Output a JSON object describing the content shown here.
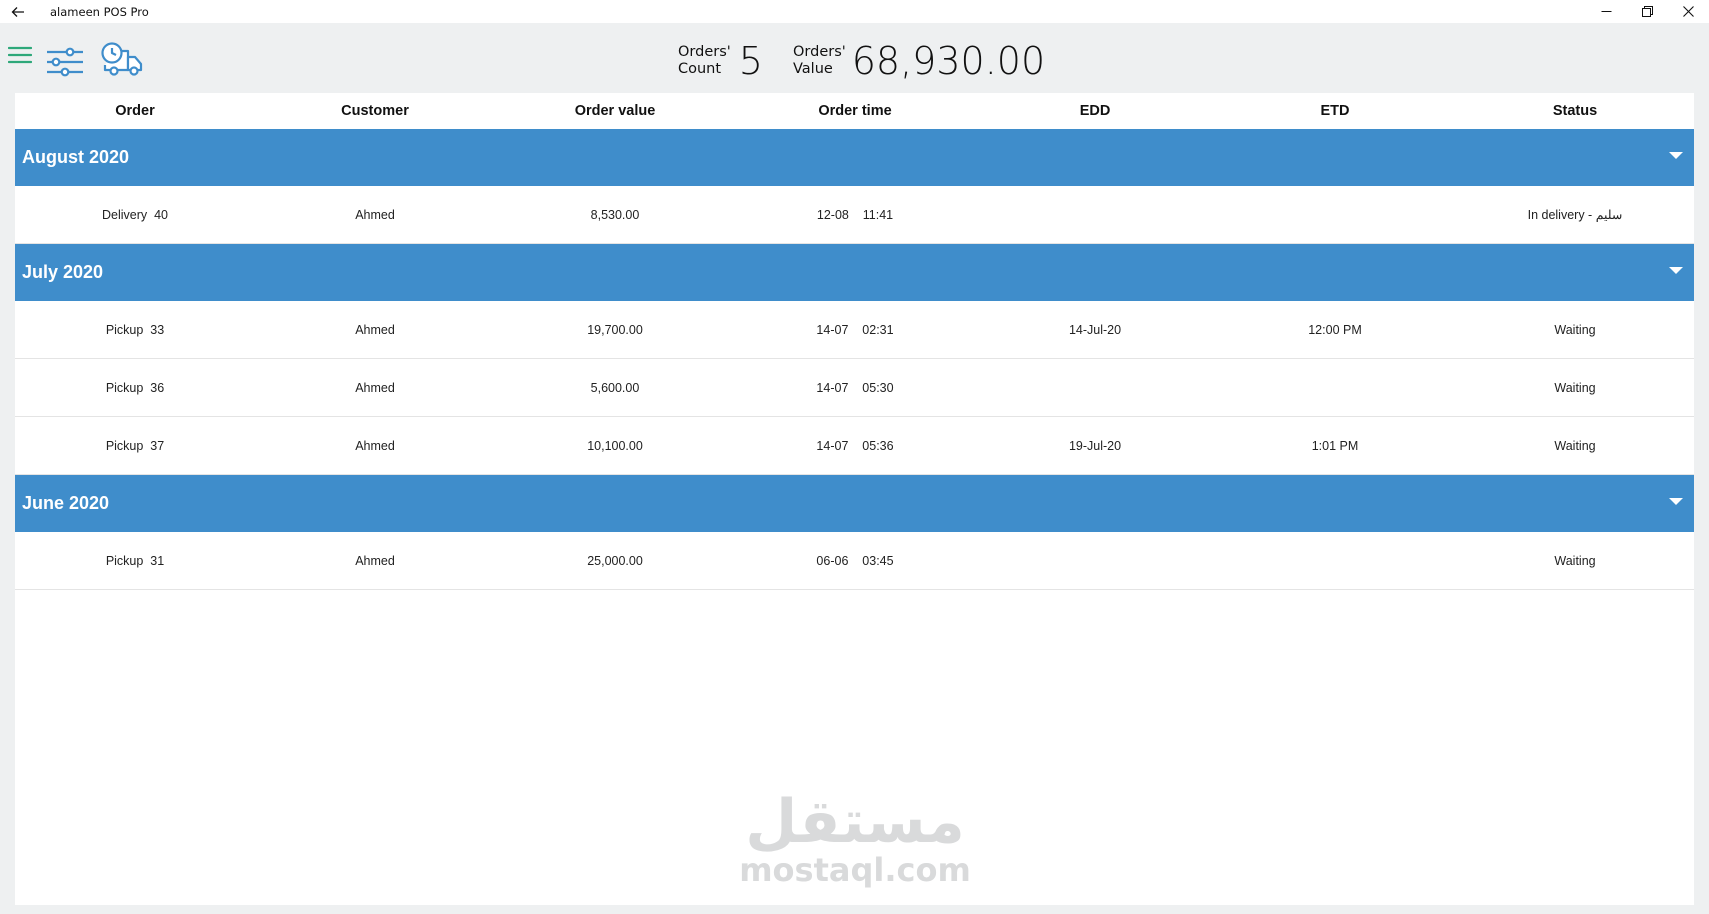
{
  "window": {
    "title": "alameen POS Pro",
    "controls": [
      "minimize-icon",
      "restore-icon",
      "close-icon"
    ]
  },
  "toolbar": {
    "icons": [
      "menu-icon",
      "filter-sliders-icon",
      "delivery-truck-clock-icon"
    ],
    "icon_color": "#3f8dcb",
    "menu_color": "#2ea87a"
  },
  "stats": {
    "count_label_1": "Orders'",
    "count_label_2": "Count",
    "count_value": "5",
    "value_label_1": "Orders'",
    "value_label_2": "Value",
    "value_value": "68,930.00"
  },
  "columns": [
    "Order",
    "Customer",
    "Order value",
    "Order time",
    "EDD",
    "ETD",
    "Status"
  ],
  "groups": [
    {
      "title": "August 2020",
      "rows": [
        {
          "order": "Delivery  40",
          "customer": "Ahmed",
          "value": "8,530.00",
          "time": "12-08    11:41",
          "edd": "",
          "etd": "",
          "status": "In delivery - سليم"
        }
      ]
    },
    {
      "title": "July 2020",
      "rows": [
        {
          "order": "Pickup  33",
          "customer": "Ahmed",
          "value": "19,700.00",
          "time": "14-07    02:31",
          "edd": "14-Jul-20",
          "etd": "12:00 PM",
          "status": "Waiting"
        },
        {
          "order": "Pickup  36",
          "customer": "Ahmed",
          "value": "5,600.00",
          "time": "14-07    05:30",
          "edd": "",
          "etd": "",
          "status": "Waiting"
        },
        {
          "order": "Pickup  37",
          "customer": "Ahmed",
          "value": "10,100.00",
          "time": "14-07    05:36",
          "edd": "19-Jul-20",
          "etd": "1:01 PM",
          "status": "Waiting"
        }
      ]
    },
    {
      "title": "June 2020",
      "rows": [
        {
          "order": "Pickup  31",
          "customer": "Ahmed",
          "value": "25,000.00",
          "time": "06-06    03:45",
          "edd": "",
          "etd": "",
          "status": "Waiting"
        }
      ]
    }
  ],
  "colors": {
    "group_header": "#3f8dcb",
    "background": "#eef0f1"
  },
  "watermark": {
    "arabic": "مستقل",
    "latin": "mostaql.com"
  }
}
